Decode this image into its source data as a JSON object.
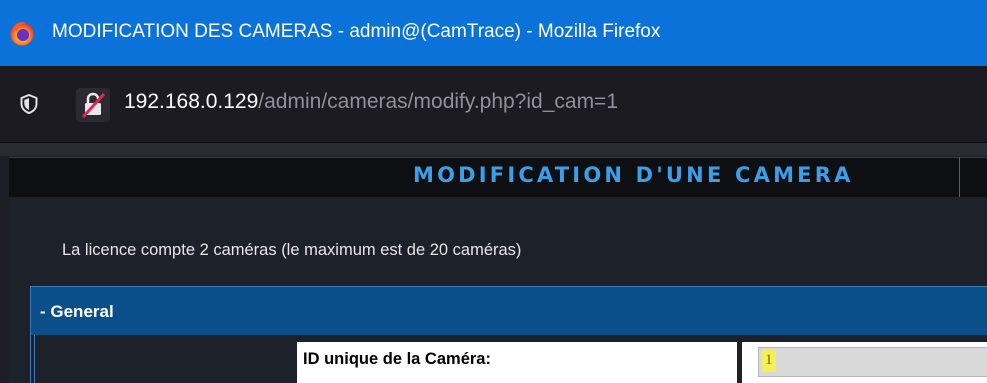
{
  "window": {
    "title": "MODIFICATION DES CAMERAS - admin@(CamTrace) - Mozilla Firefox",
    "icon": "firefox-logo-icon"
  },
  "urlbar": {
    "shield_icon": "shield-icon",
    "security_icon": "insecure-lock-icon",
    "host": "192.168.0.129",
    "path": "/admin/cameras/modify.php?id_cam=1"
  },
  "page": {
    "title": "MODIFICATION D'UNE CAMERA",
    "license_text": "La licence compte 2 caméras (le maximum est de 20 caméras)",
    "section": {
      "label": "- General",
      "fields": [
        {
          "label": "ID unique de la Caméra:",
          "value": "1"
        }
      ]
    }
  },
  "colors": {
    "titlebar": "#0a72d8",
    "page_title": "#3c9ee6",
    "section_header": "#0a4f8a",
    "highlight": "#f4ee5a"
  }
}
